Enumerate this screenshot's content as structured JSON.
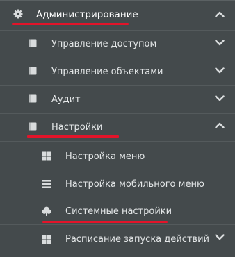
{
  "colors": {
    "panel": "#444a4c",
    "text": "#e4e7e8",
    "icon": "#d9dcdd",
    "underline": "#e3142a"
  },
  "menu": {
    "root": {
      "label": "Администрирование",
      "icon": "gear-icon",
      "state": "expanded"
    },
    "items": [
      {
        "label": "Управление доступом",
        "icon": "book-icon",
        "state": "collapsed"
      },
      {
        "label": "Управление объектами",
        "icon": "book-icon",
        "state": "collapsed"
      },
      {
        "label": "Аудит",
        "icon": "book-icon",
        "state": "collapsed"
      },
      {
        "label": "Настройки",
        "icon": "book-icon",
        "state": "expanded"
      }
    ],
    "sub_items": [
      {
        "label": "Настройка меню",
        "icon": "grid-icon"
      },
      {
        "label": "Настройка мобильного меню",
        "icon": "list-icon"
      },
      {
        "label": "Системные настройки",
        "icon": "tree-icon"
      },
      {
        "label": "Расписание запуска действий",
        "icon": "grid-icon",
        "state": "collapsed"
      }
    ]
  }
}
